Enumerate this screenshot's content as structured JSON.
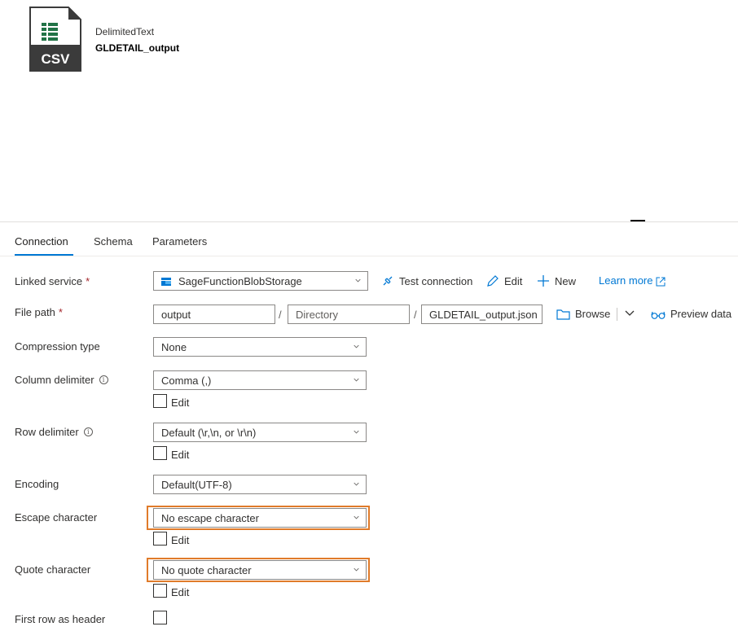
{
  "dataset": {
    "icon": "csv-file-icon",
    "icon_text": "CSV",
    "type": "DelimitedText",
    "name": "GLDETAIL_output"
  },
  "tabs": [
    {
      "label": "Connection",
      "active": true
    },
    {
      "label": "Schema",
      "active": false
    },
    {
      "label": "Parameters",
      "active": false
    }
  ],
  "form": {
    "linked_service": {
      "label": "Linked service",
      "required_mark": "*",
      "value": "SageFunctionBlobStorage",
      "actions": {
        "test_connection": "Test connection",
        "edit": "Edit",
        "new": "New",
        "learn_more": "Learn more"
      }
    },
    "file_path": {
      "label": "File path",
      "required_mark": "*",
      "container": "output",
      "directory_placeholder": "Directory",
      "file": "GLDETAIL_output.json",
      "separator": "/",
      "browse": "Browse",
      "preview": "Preview data"
    },
    "compression_type": {
      "label": "Compression type",
      "value": "None"
    },
    "column_delimiter": {
      "label": "Column delimiter",
      "value": "Comma (,)",
      "edit_label": "Edit"
    },
    "row_delimiter": {
      "label": "Row delimiter",
      "value": "Default (\\r,\\n, or \\r\\n)",
      "edit_label": "Edit"
    },
    "encoding": {
      "label": "Encoding",
      "value": "Default(UTF-8)"
    },
    "escape_character": {
      "label": "Escape character",
      "value": "No escape character",
      "edit_label": "Edit"
    },
    "quote_character": {
      "label": "Quote character",
      "value": "No quote character",
      "edit_label": "Edit"
    },
    "first_row_as_header": {
      "label": "First row as header",
      "checked": false
    }
  },
  "colors": {
    "accent": "#0078d4",
    "highlight": "#e07b2a",
    "csv_green": "#217346",
    "required": "#a4262c"
  }
}
